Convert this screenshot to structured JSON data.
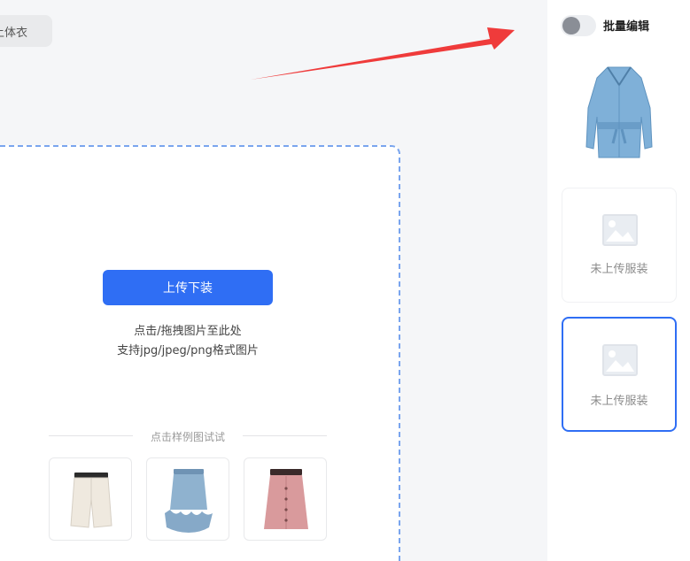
{
  "top_tab": {
    "label": "上体衣"
  },
  "upload": {
    "button_label": "上传下装",
    "hint_line1": "点击/拖拽图片至此处",
    "hint_line2": "支持jpg/jpeg/png格式图片"
  },
  "samples": {
    "label": "点击样例图试试",
    "items": [
      {
        "name": "white-pleated-shorts",
        "color": "#efe9df"
      },
      {
        "name": "blue-ruffle-skirt",
        "color": "#8fb2cf"
      },
      {
        "name": "pink-button-skirt",
        "color": "#d99a9c"
      }
    ]
  },
  "side": {
    "batch_edit_label": "批量编辑",
    "batch_edit_on": false,
    "slots": [
      {
        "state": "uploaded",
        "item": "blue-trench-jacket"
      },
      {
        "state": "empty",
        "label": "未上传服装"
      },
      {
        "state": "empty-selected",
        "label": "未上传服装"
      }
    ]
  },
  "colors": {
    "accent": "#2f6ef4",
    "annotation_arrow": "#ef3b3b",
    "dashed_border": "#7aa5ee"
  }
}
